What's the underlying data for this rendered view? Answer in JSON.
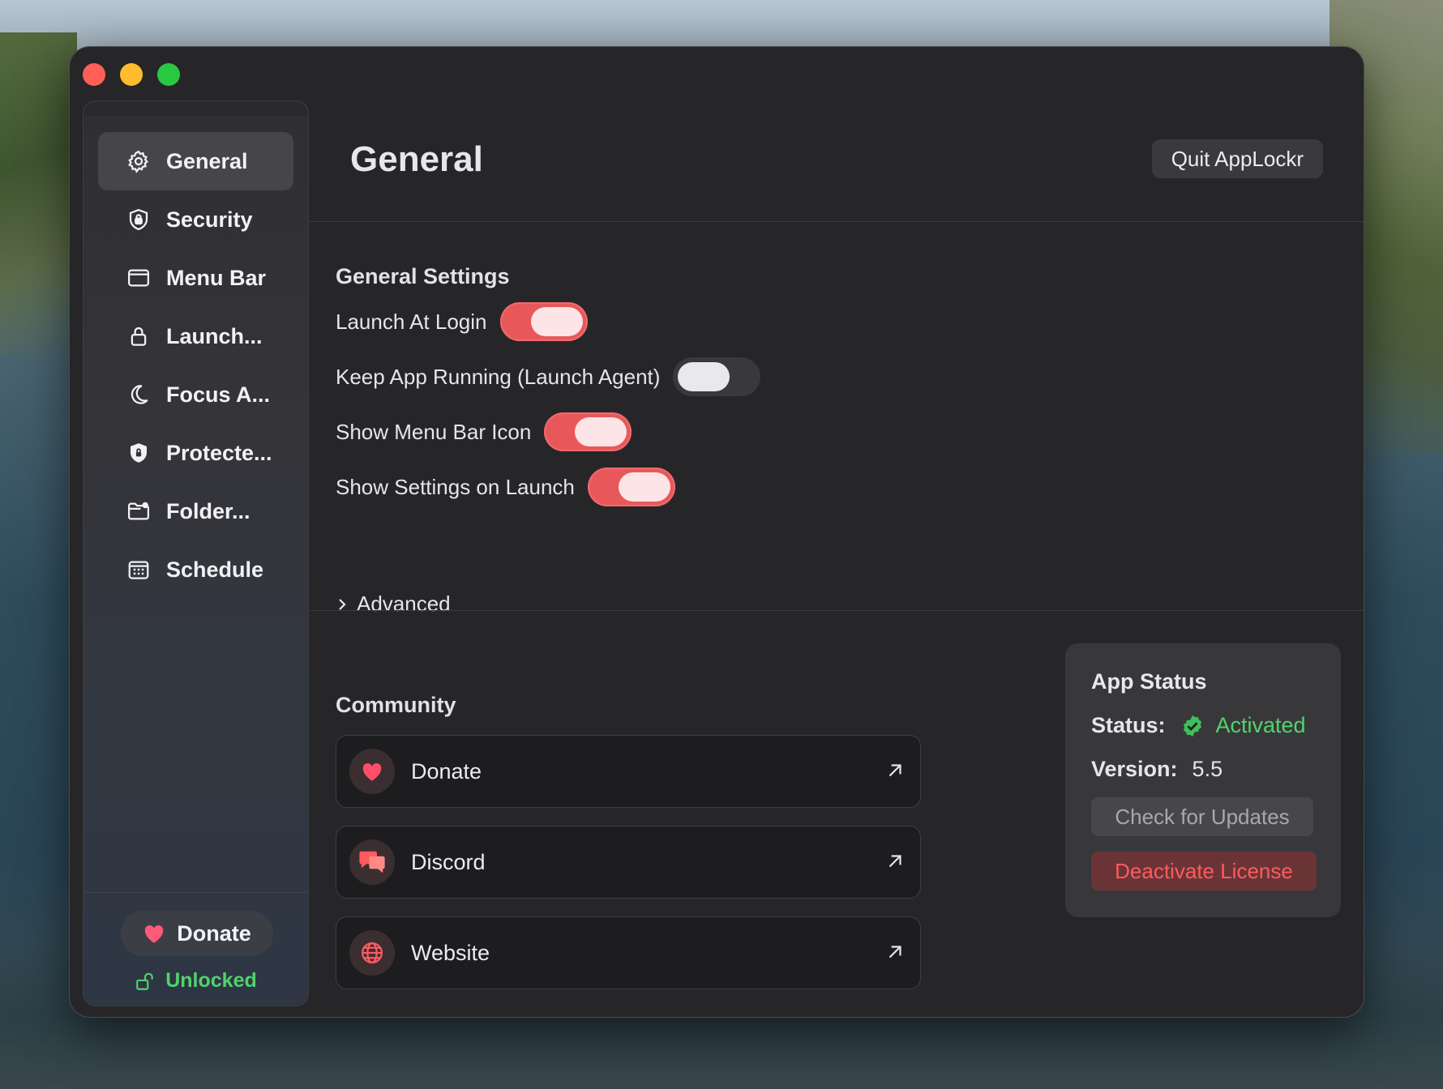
{
  "window": {
    "title": "General",
    "quit_label": "Quit AppLockr"
  },
  "sidebar": {
    "items": [
      {
        "label": "General",
        "icon": "gear-icon",
        "active": true
      },
      {
        "label": "Security",
        "icon": "shield-lock-icon"
      },
      {
        "label": "Menu Bar",
        "icon": "menubar-window-icon"
      },
      {
        "label": "Launch...",
        "icon": "lock-icon"
      },
      {
        "label": "Focus A...",
        "icon": "moon-icon"
      },
      {
        "label": "Protecte...",
        "icon": "shield-icon"
      },
      {
        "label": "Folder...",
        "icon": "folder-lock-icon"
      },
      {
        "label": "Schedule",
        "icon": "calendar-icon"
      }
    ],
    "donate_label": "Donate",
    "unlocked_label": "Unlocked"
  },
  "general_settings": {
    "title": "General Settings",
    "rows": [
      {
        "label": "Launch At Login",
        "on": true
      },
      {
        "label": "Keep App Running (Launch Agent)",
        "on": false
      },
      {
        "label": "Show Menu Bar Icon",
        "on": true
      },
      {
        "label": "Show Settings on Launch",
        "on": true
      }
    ],
    "advanced_label": "Advanced"
  },
  "community": {
    "title": "Community",
    "links": [
      {
        "label": "Donate",
        "icon": "heart-icon"
      },
      {
        "label": "Discord",
        "icon": "chat-bubbles-icon"
      },
      {
        "label": "Website",
        "icon": "globe-icon"
      }
    ]
  },
  "app_status": {
    "title": "App Status",
    "status_key": "Status:",
    "status_value": "Activated",
    "version_key": "Version:",
    "version_value": "5.5",
    "check_updates_label": "Check for Updates",
    "deactivate_label": "Deactivate License"
  },
  "colors": {
    "accent_red": "#e8585a",
    "success_green": "#53d36c"
  }
}
